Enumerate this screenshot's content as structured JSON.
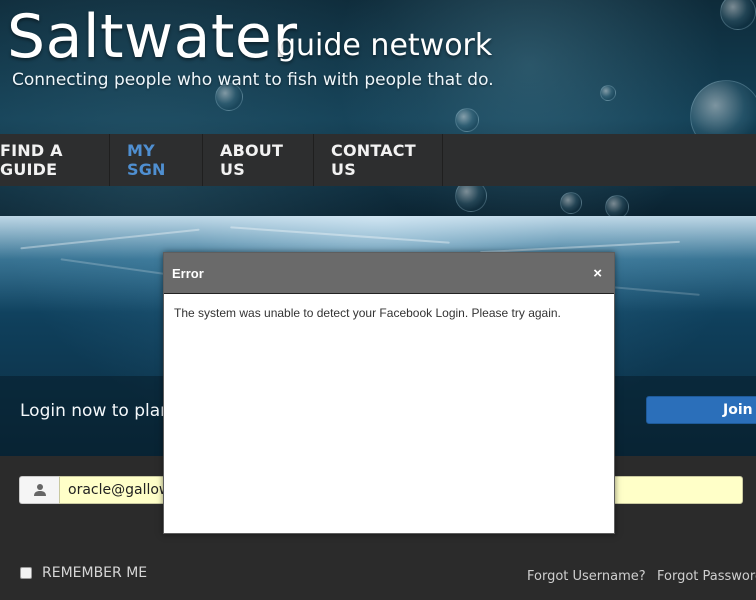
{
  "header": {
    "brand_main": "Saltwater",
    "brand_sub": "guide network",
    "tagline": "Connecting people who want to fish with people that do."
  },
  "nav": {
    "items": [
      {
        "label": "FIND A GUIDE"
      },
      {
        "label": "MY SGN",
        "active": true
      },
      {
        "label": "ABOUT US"
      },
      {
        "label": "CONTACT US"
      }
    ]
  },
  "banner": {
    "login_text": "Login now to plan",
    "join_label": "Join u"
  },
  "login_form": {
    "username_value": "oracle@gallowa",
    "remember_label": "REMEMBER ME",
    "forgot_username": "Forgot Username?",
    "forgot_password": "Forgot Password?"
  },
  "dialog": {
    "title": "Error",
    "close_label": "×",
    "message": "The system was unable to detect your Facebook Login. Please try again."
  },
  "colors": {
    "nav_active": "#4f8fd1",
    "join_button": "#2b6fba",
    "input_autofill": "#ffffc8",
    "dialog_header": "#6a6a6a"
  }
}
